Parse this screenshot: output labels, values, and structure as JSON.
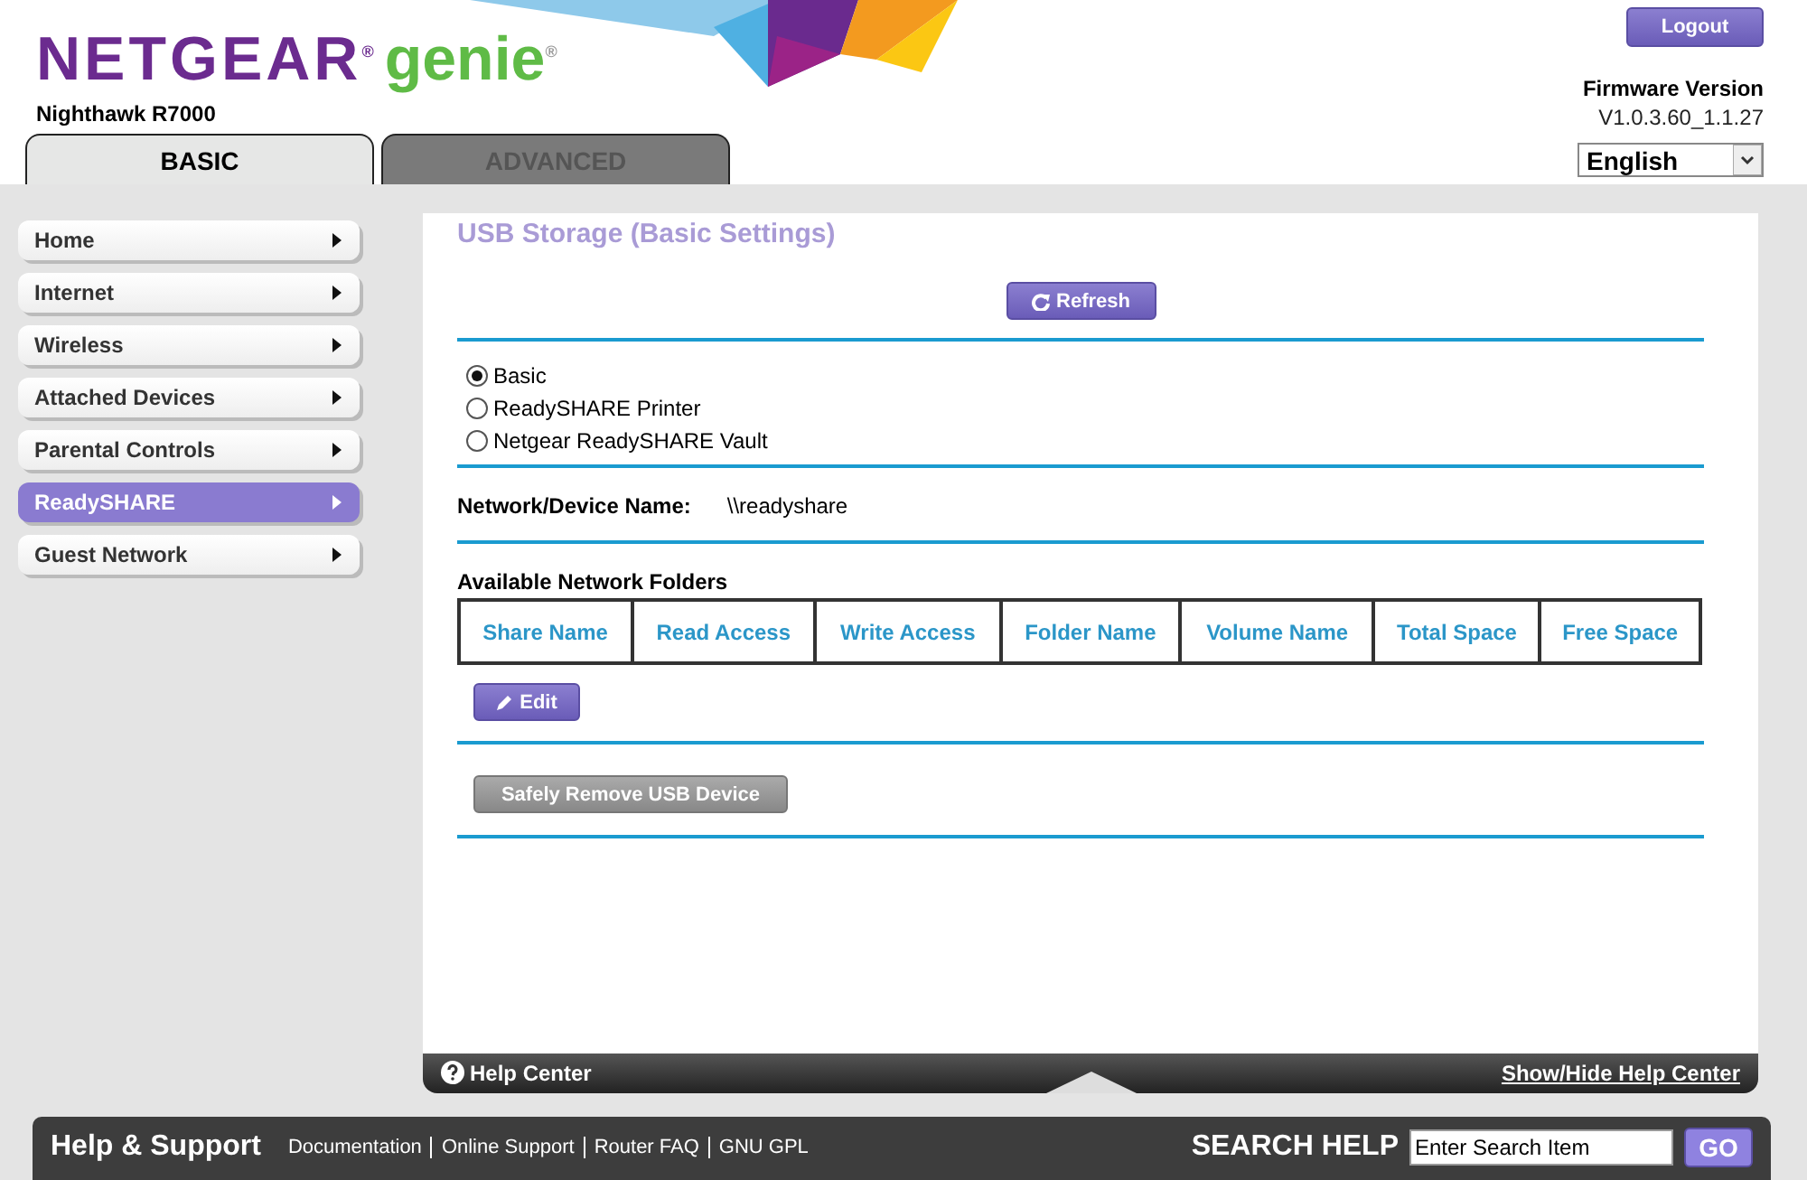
{
  "header": {
    "brand": "NETGEAR$^{®}$",
    "product": "genie$^{®}$",
    "model": "Nighthawk R7000",
    "logout": "Logout",
    "firmware_label": "Firmware Version",
    "firmware_version": "V1.0.3.60_1.1.27",
    "language": "English"
  },
  "tabs": [
    {
      "label": "BASIC",
      "selected": true
    },
    {
      "label": "ADVANCED",
      "selected": false
    }
  ],
  "sidebar": {
    "items": [
      {
        "label": "Home",
        "selected": false
      },
      {
        "label": "Internet",
        "selected": false
      },
      {
        "label": "Wireless",
        "selected": false
      },
      {
        "label": "Attached Devices",
        "selected": false
      },
      {
        "label": "Parental Controls",
        "selected": false
      },
      {
        "label": "ReadySHARE",
        "selected": true
      },
      {
        "label": "Guest Network",
        "selected": false
      }
    ]
  },
  "content": {
    "title": "USB Storage (Basic Settings)",
    "refresh": "Refresh",
    "modes": [
      {
        "label": "Basic",
        "selected": true
      },
      {
        "label": "ReadySHARE Printer",
        "selected": false
      },
      {
        "label": "Netgear ReadySHARE Vault",
        "selected": false
      }
    ],
    "device_name_label": "Network/Device Name:",
    "device_name": "\\\\readyshare",
    "folders_title": "Available Network Folders",
    "table": {
      "columns": [
        "Share Name",
        "Read Access",
        "Write Access",
        "Folder Name",
        "Volume Name",
        "Total Space",
        "Free Space"
      ]
    },
    "edit": "Edit",
    "safely_remove": "Safely Remove USB Device"
  },
  "help_bar": {
    "label": "Help Center",
    "toggle": "Show/Hide Help Center"
  },
  "footer": {
    "title": "Help & Support",
    "links": [
      "Documentation",
      "Online Support",
      "Router FAQ",
      "GNU GPL"
    ],
    "search_label": "SEARCH HELP",
    "search_placeholder": "Enter Search Item",
    "go": "GO"
  }
}
